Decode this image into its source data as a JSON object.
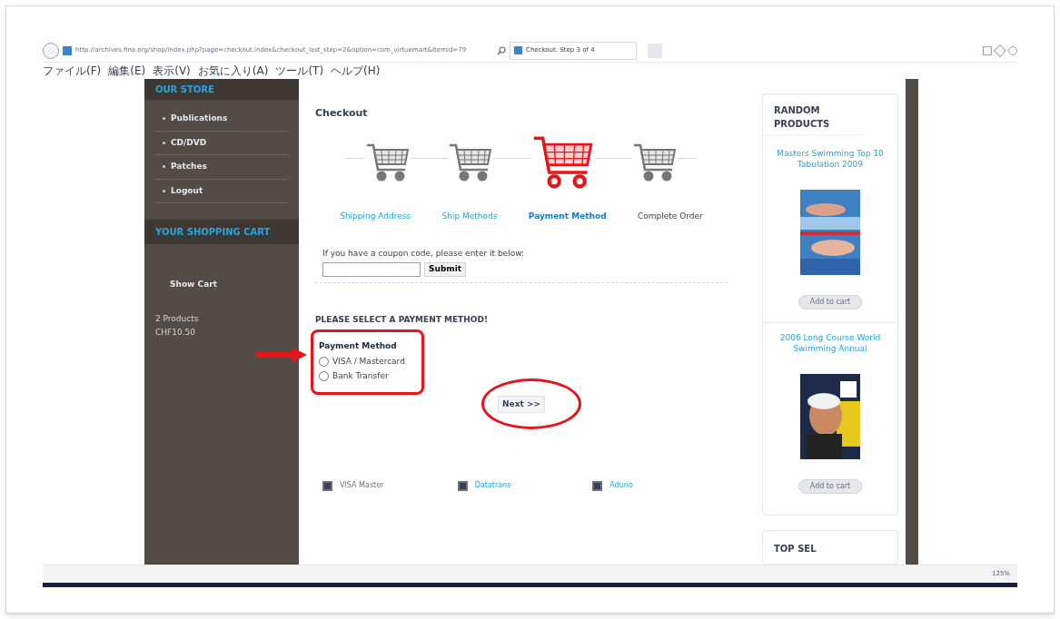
{
  "browser": {
    "address": "http://archives.fina.org/shop/index.php?page=checkout.index&checkout_last_step=2&option=com_virtuemart&Itemid=79",
    "tab_title": "Checkout: Step 3 of 4",
    "menu": [
      "ファイル(F)",
      "編集(E)",
      "表示(V)",
      "お気に入り(A)",
      "ツール(T)",
      "ヘルプ(H)"
    ],
    "zoom": "125%"
  },
  "sidebar": {
    "store_title": "OUR STORE",
    "items": [
      {
        "label": "Publications"
      },
      {
        "label": "CD/DVD"
      },
      {
        "label": "Patches"
      },
      {
        "label": "Logout"
      }
    ],
    "cart_title": "YOUR SHOPPING CART",
    "show_cart": "Show Cart",
    "products": "2 Products",
    "total": "CHF10.50"
  },
  "checkout": {
    "title": "Checkout",
    "steps": [
      {
        "label": "Shipping Address",
        "selected": false,
        "kind": "link"
      },
      {
        "label": "Ship Methods",
        "selected": false,
        "kind": "link"
      },
      {
        "label": "Payment Method",
        "selected": true,
        "kind": "link"
      },
      {
        "label": "Complete Order",
        "selected": false,
        "kind": "text"
      }
    ],
    "coupon_prompt": "If you have a coupon code, please enter it below:",
    "coupon_button": "Submit",
    "payment_heading": "PLEASE SELECT A PAYMENT METHOD!",
    "payment_label": "Payment Method",
    "payment_options": [
      {
        "label": "VISA / Mastercard",
        "selected": false
      },
      {
        "label": "Bank Transfer",
        "selected": false
      }
    ],
    "next_button": "Next >>",
    "logos": [
      {
        "label": "VISA Master",
        "kind": "text"
      },
      {
        "label": "Datatrans",
        "kind": "link"
      },
      {
        "label": "Aduno",
        "kind": "link"
      }
    ]
  },
  "random_products": {
    "title": "RANDOM PRODUCTS",
    "products": [
      {
        "name": "Masters Swimming Top 10 Tabulation 2009",
        "button": "Add to cart",
        "kind": "picture"
      },
      {
        "name": "2006 Long Course World Swimming Annual",
        "button": "Add to cart",
        "kind": "picture"
      }
    ]
  },
  "top_seller": {
    "title": "TOP SEL"
  }
}
